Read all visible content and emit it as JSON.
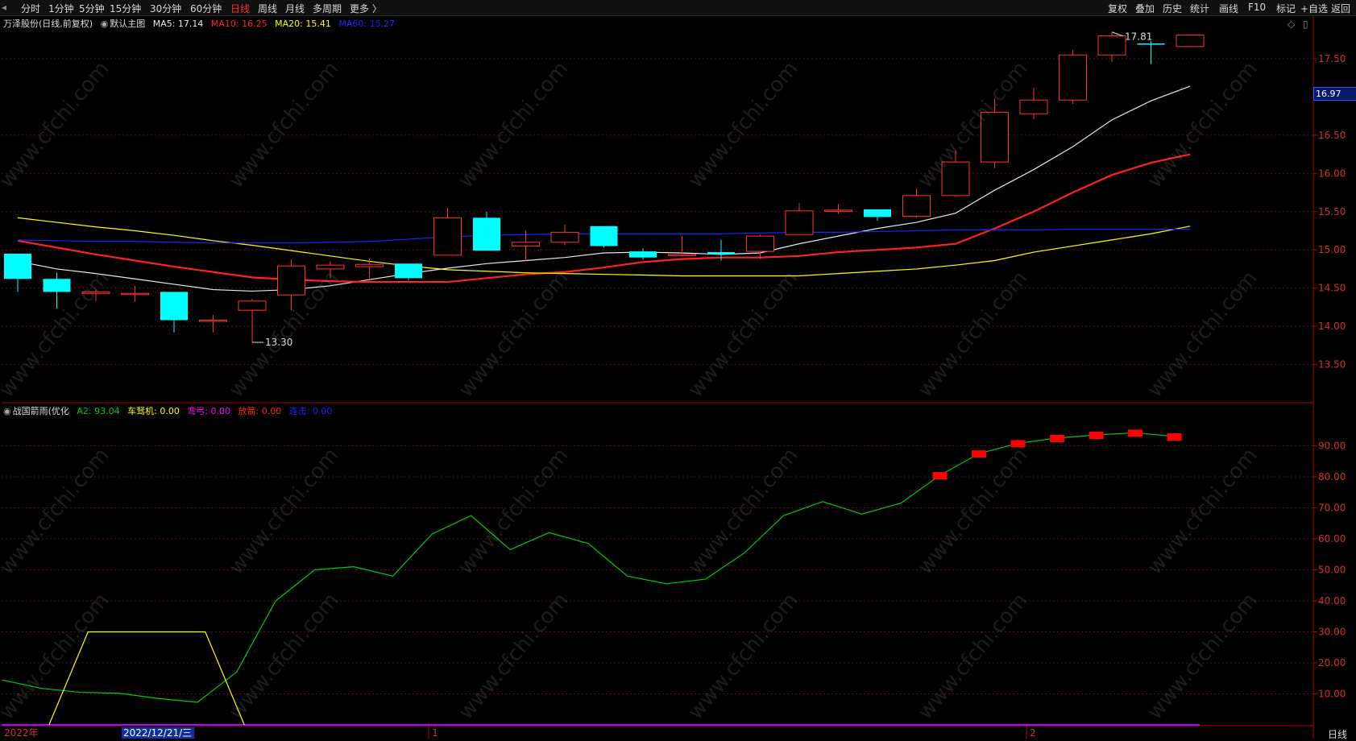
{
  "topbar": {
    "left": [
      "分时",
      "1分钟",
      "5分钟",
      "15分钟",
      "30分钟",
      "60分钟",
      "日线",
      "周线",
      "月线",
      "多周期",
      "更多 〉"
    ],
    "active": "日线",
    "right": [
      "复权",
      "叠加",
      "历史",
      "统计",
      "画线",
      "F10",
      "标记",
      "+自选",
      "返回"
    ]
  },
  "main_legend": {
    "stock": "万泽股份",
    "mode": "(日线,前复权)",
    "template": "默认主图",
    "ma5": "MA5: 17.14",
    "ma10": "MA10: 16.25",
    "ma20": "MA20: 15.41",
    "ma60": "MA60: 15.27"
  },
  "sub_legend": {
    "name": "战国箭雨(优化",
    "a2": "A2: 93.04",
    "chenuji": "车驽机: 0.00",
    "wangong": "弯弓: 0.00",
    "fangjian": "放箭: 0.00",
    "lianji": "连击: 0.00"
  },
  "price_tag": "16.97",
  "period_label": "日线",
  "watermark": "www.cfchi.com",
  "colors": {
    "up": "#ff3232",
    "down": "#00ffff",
    "ma5": "#e8e8e8",
    "ma10": "#ff2020",
    "ma20": "#ffff00",
    "ma60": "#2020ff",
    "a2": "#00cc00",
    "yellow": "#ffff00",
    "signal": "#ff0000",
    "purple": "#b000ff",
    "axis": "#b00000"
  },
  "chart_data": [
    {
      "type": "candlestick",
      "title": "万泽股份 (日线,前复权)",
      "ylim": [
        13.0,
        17.9
      ],
      "y_ticks": [
        13.5,
        14.0,
        14.5,
        15.0,
        15.5,
        16.0,
        16.5,
        17.5
      ],
      "x_labels": [
        "2022年",
        "2022/12/21/三",
        "1",
        "2"
      ],
      "annotations": [
        "17.81",
        "13.30"
      ],
      "candles": [
        {
          "o": 14.95,
          "c": 14.62,
          "h": 14.95,
          "l": 14.45
        },
        {
          "o": 14.62,
          "c": 14.45,
          "h": 14.7,
          "l": 14.23
        },
        {
          "o": 14.43,
          "c": 14.45,
          "h": 14.48,
          "l": 14.33
        },
        {
          "o": 14.43,
          "c": 14.43,
          "h": 14.53,
          "l": 14.32
        },
        {
          "o": 14.45,
          "c": 14.08,
          "h": 14.45,
          "l": 13.92
        },
        {
          "o": 14.08,
          "c": 14.08,
          "h": 14.15,
          "l": 13.92
        },
        {
          "o": 14.21,
          "c": 14.33,
          "h": 14.36,
          "l": 13.79
        },
        {
          "o": 14.41,
          "c": 14.79,
          "h": 14.88,
          "l": 14.21
        },
        {
          "o": 14.75,
          "c": 14.8,
          "h": 14.85,
          "l": 14.63
        },
        {
          "o": 14.78,
          "c": 14.81,
          "h": 14.88,
          "l": 14.63
        },
        {
          "o": 14.82,
          "c": 14.63,
          "h": 14.82,
          "l": 14.6
        },
        {
          "o": 14.93,
          "c": 15.42,
          "h": 15.55,
          "l": 14.93
        },
        {
          "o": 15.42,
          "c": 14.99,
          "h": 15.5,
          "l": 14.99
        },
        {
          "o": 15.05,
          "c": 15.1,
          "h": 15.25,
          "l": 14.85
        },
        {
          "o": 15.1,
          "c": 15.23,
          "h": 15.33,
          "l": 15.06
        },
        {
          "o": 15.31,
          "c": 15.05,
          "h": 15.31,
          "l": 15.03
        },
        {
          "o": 14.98,
          "c": 14.9,
          "h": 15.02,
          "l": 14.87
        },
        {
          "o": 14.93,
          "c": 14.94,
          "h": 15.18,
          "l": 14.93
        },
        {
          "o": 14.97,
          "c": 14.94,
          "h": 15.13,
          "l": 14.86
        },
        {
          "o": 14.98,
          "c": 15.18,
          "h": 15.2,
          "l": 14.88
        },
        {
          "o": 15.2,
          "c": 15.51,
          "h": 15.61,
          "l": 15.2
        },
        {
          "o": 15.51,
          "c": 15.52,
          "h": 15.6,
          "l": 15.47
        },
        {
          "o": 15.53,
          "c": 15.43,
          "h": 15.53,
          "l": 15.38
        },
        {
          "o": 15.44,
          "c": 15.71,
          "h": 15.8,
          "l": 15.42
        },
        {
          "o": 15.71,
          "c": 16.15,
          "h": 16.3,
          "l": 15.7
        },
        {
          "o": 16.15,
          "c": 16.8,
          "h": 16.98,
          "l": 16.07
        },
        {
          "o": 16.78,
          "c": 16.96,
          "h": 17.12,
          "l": 16.71
        },
        {
          "o": 16.96,
          "c": 17.55,
          "h": 17.61,
          "l": 16.91
        },
        {
          "o": 17.55,
          "c": 17.8,
          "h": 17.85,
          "l": 17.46
        },
        {
          "o": 17.7,
          "c": 17.69,
          "h": 17.73,
          "l": 17.43
        },
        {
          "o": 17.66,
          "c": 17.81,
          "h": 17.81,
          "l": 17.66
        }
      ],
      "series": [
        {
          "name": "MA5",
          "values": [
            14.85,
            14.75,
            14.69,
            14.62,
            14.55,
            14.48,
            14.46,
            14.48,
            14.53,
            14.61,
            14.69,
            14.76,
            14.82,
            14.86,
            14.9,
            14.96,
            14.97,
            14.96,
            14.94,
            14.96,
            15.08,
            15.18,
            15.28,
            15.36,
            15.48,
            15.78,
            16.05,
            16.35,
            16.7,
            16.95,
            17.14
          ]
        },
        {
          "name": "MA10",
          "values": [
            15.12,
            15.03,
            14.94,
            14.86,
            14.78,
            14.71,
            14.64,
            14.61,
            14.59,
            14.58,
            14.58,
            14.58,
            14.63,
            14.68,
            14.71,
            14.77,
            14.84,
            14.88,
            14.9,
            14.9,
            14.92,
            14.97,
            15.0,
            15.03,
            15.08,
            15.28,
            15.5,
            15.75,
            15.98,
            16.14,
            16.25
          ]
        },
        {
          "name": "MA20",
          "values": [
            15.42,
            15.36,
            15.3,
            15.25,
            15.19,
            15.12,
            15.06,
            14.99,
            14.92,
            14.85,
            14.79,
            14.74,
            14.72,
            14.7,
            14.69,
            14.68,
            14.67,
            14.66,
            14.66,
            14.66,
            14.66,
            14.69,
            14.72,
            14.75,
            14.8,
            14.86,
            14.97,
            15.05,
            15.13,
            15.21,
            15.31
          ]
        },
        {
          "name": "MA60",
          "values": [
            15.13,
            15.12,
            15.11,
            15.11,
            15.1,
            15.09,
            15.09,
            15.09,
            15.1,
            15.11,
            15.14,
            15.17,
            15.19,
            15.2,
            15.21,
            15.21,
            15.21,
            15.21,
            15.21,
            15.22,
            15.23,
            15.23,
            15.24,
            15.25,
            15.26,
            15.26,
            15.26,
            15.27,
            15.27,
            15.27,
            15.27
          ]
        }
      ]
    },
    {
      "type": "line",
      "title": "战国箭雨(优化",
      "ylim": [
        0,
        100
      ],
      "y_ticks": [
        10,
        20,
        30,
        40,
        50,
        60,
        70,
        80,
        90
      ],
      "series": [
        {
          "name": "A2",
          "values": [
            14.5,
            11.8,
            10.5,
            10.2,
            8.5,
            7.3,
            17.0,
            40.0,
            50.0,
            51.0,
            48.0,
            61.5,
            67.5,
            56.5,
            62.0,
            58.5,
            48.0,
            45.5,
            47.0,
            55.5,
            67.5,
            72.0,
            68.0,
            71.5,
            80.5,
            87.5,
            90.8,
            92.5,
            93.5,
            94.2,
            93.0
          ]
        },
        {
          "name": "yellow_line",
          "values": [
            null,
            0,
            30,
            30,
            30,
            30,
            0
          ]
        },
        {
          "name": "signal_bars",
          "values": [
            null,
            null,
            null,
            null,
            null,
            null,
            null,
            null,
            null,
            null,
            null,
            null,
            null,
            null,
            null,
            null,
            null,
            null,
            null,
            null,
            null,
            null,
            null,
            null,
            80.5,
            87.5,
            90.8,
            92.5,
            93.5,
            94.2,
            93.0
          ]
        }
      ]
    }
  ]
}
